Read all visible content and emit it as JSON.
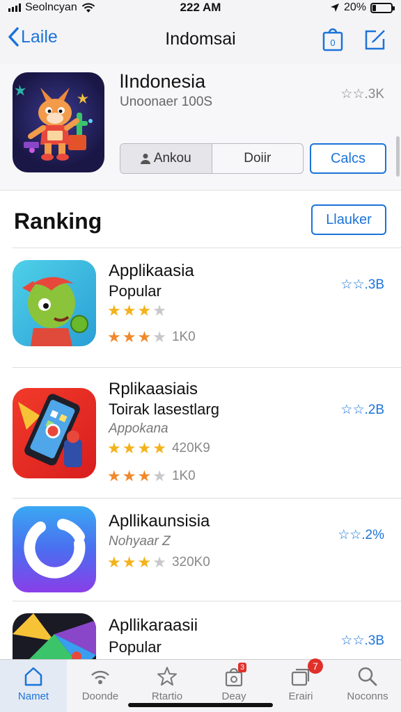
{
  "status_bar": {
    "carrier": "Seolncyan",
    "time": "222 AM",
    "battery": "20%",
    "battery_level": 0.2
  },
  "nav": {
    "back_label": "Laile",
    "title": "Indomsai",
    "bag_count": "0"
  },
  "hero": {
    "title": "lIndonesia",
    "subtitle": "Unoonaer 100S",
    "rating": "☆☆.3K",
    "segments": [
      "Ankou",
      "Doiir"
    ],
    "cancel_label": "Calcs"
  },
  "section": {
    "title": "Ranking",
    "more_label": "Llauker"
  },
  "apps": [
    {
      "name": "Applikaasia",
      "line1": "Popular",
      "rating": "☆☆.3B",
      "stars1": 3,
      "stars1_style": "gold",
      "stars2": 3,
      "stars2_style": "orange",
      "count2": "1K0"
    },
    {
      "name": "Rplikaasiais",
      "line1": "Toirak lasestlarg",
      "line2": "Appokana",
      "rating": "☆☆.2B",
      "stars1": 4,
      "stars1_style": "gold",
      "count1": "420K9",
      "stars2": 3,
      "stars2_style": "orange",
      "count2": "1K0"
    },
    {
      "name": "Apllikaunsisia",
      "line2": "Nohyaar Z",
      "rating": "☆☆.2%",
      "stars1": 3,
      "stars1_style": "gold",
      "count1": "320K0"
    },
    {
      "name": "Apllikaraasii",
      "line1": "Popular",
      "rating": "☆☆.3B"
    }
  ],
  "tabs": [
    {
      "label": "Namet",
      "icon": "home-icon",
      "active": true
    },
    {
      "label": "Doonde",
      "icon": "wifi-icon"
    },
    {
      "label": "Rtartio",
      "icon": "star-icon"
    },
    {
      "label": "Deay",
      "icon": "bag-icon",
      "badge": "3"
    },
    {
      "label": "Erairi",
      "icon": "cards-icon",
      "badge": "7"
    },
    {
      "label": "Noconns",
      "icon": "search-icon"
    }
  ],
  "colors": {
    "accent": "#1a73d9",
    "star": "#f3b21b",
    "badge": "#e0302a"
  }
}
